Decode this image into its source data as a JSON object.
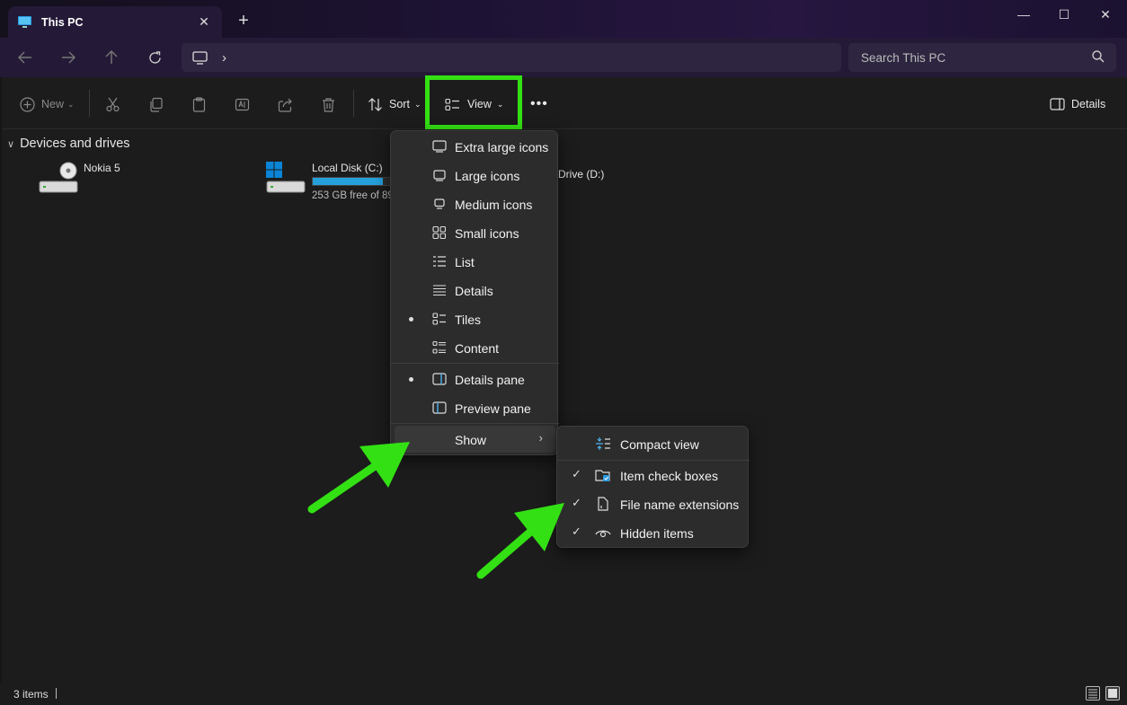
{
  "window": {
    "tab_title": "This PC",
    "tab_close": "✕",
    "new_tab": "+",
    "minimize": "—",
    "maximize": "☐",
    "close": "✕"
  },
  "nav": {
    "back_icon": "arrow-left-icon",
    "forward_icon": "arrow-right-icon",
    "up_icon": "arrow-up-icon",
    "refresh_icon": "refresh-icon",
    "address_chevron": "›",
    "search_placeholder": "Search This PC"
  },
  "toolbar": {
    "new_label": "New",
    "sort_label": "Sort",
    "view_label": "View",
    "details_label": "Details",
    "more": "•••"
  },
  "content": {
    "group_label": "Devices and drives",
    "drives": [
      {
        "name": "Nokia 5",
        "sub": ""
      },
      {
        "name": "Local Disk (C:)",
        "sub": "253 GB free of 89",
        "usage_fraction": 0.72
      },
      {
        "name": "Drive (D:)",
        "sub": ""
      }
    ]
  },
  "view_menu": {
    "items": [
      {
        "label": "Extra large icons",
        "icon": "monitor-large-icon",
        "selected": false
      },
      {
        "label": "Large icons",
        "icon": "monitor-icon",
        "selected": false
      },
      {
        "label": "Medium icons",
        "icon": "monitor-small-icon",
        "selected": false
      },
      {
        "label": "Small icons",
        "icon": "grid-icon",
        "selected": false
      },
      {
        "label": "List",
        "icon": "list-icon",
        "selected": false
      },
      {
        "label": "Details",
        "icon": "details-lines-icon",
        "selected": false
      },
      {
        "label": "Tiles",
        "icon": "tiles-icon",
        "selected": true
      },
      {
        "label": "Content",
        "icon": "content-icon",
        "selected": false
      }
    ],
    "pane_items": [
      {
        "label": "Details pane",
        "icon": "details-pane-icon",
        "selected": true
      },
      {
        "label": "Preview pane",
        "icon": "preview-pane-icon",
        "selected": false
      }
    ],
    "show_label": "Show",
    "show_arrow": "›"
  },
  "show_submenu": {
    "compact_label": "Compact view",
    "items": [
      {
        "label": "Item check boxes",
        "checked": true,
        "icon": "checkbox-folder-icon"
      },
      {
        "label": "File name extensions",
        "checked": true,
        "icon": "file-icon"
      },
      {
        "label": "Hidden items",
        "checked": true,
        "icon": "eye-icon"
      }
    ],
    "check_glyph": "✓"
  },
  "status": {
    "items_count": "3 items"
  },
  "colors": {
    "accent": "#26a0da",
    "highlight_box": "#33e014",
    "annotation_arrow": "#33e014"
  }
}
